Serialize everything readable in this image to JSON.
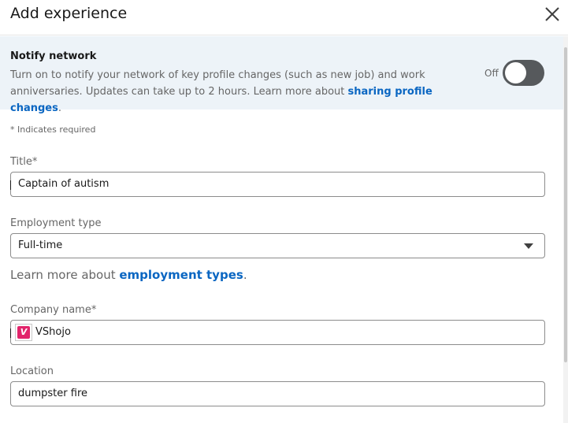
{
  "dialog": {
    "title": "Add experience"
  },
  "notify": {
    "title": "Notify network",
    "description": "Turn on to notify your network of key profile changes (such as new job) and work anniversaries. Updates can take up to 2 hours. Learn more about ",
    "link_text": "sharing profile changes",
    "period": ".",
    "toggle_state_label": "Off",
    "toggle_on": false
  },
  "form": {
    "required_note": "* Indicates required",
    "title": {
      "label": "Title*",
      "value": "Captain of autism"
    },
    "employment_type": {
      "label": "Employment type",
      "value": "Full-time"
    },
    "learn_more": {
      "prefix": "Learn more about ",
      "link_text": "employment types",
      "suffix": "."
    },
    "company": {
      "label": "Company name*",
      "value": "VShojo",
      "logo_letter": "V",
      "logo_color": "#e2246b"
    },
    "location": {
      "label": "Location",
      "value": "dumpster fire"
    }
  },
  "colors": {
    "accent": "#0a66c2",
    "notify_bg": "#edf3f8",
    "toggle_off": "#56595c"
  },
  "icons": {
    "close": "close-icon",
    "dropdown": "chevron-down-icon"
  }
}
